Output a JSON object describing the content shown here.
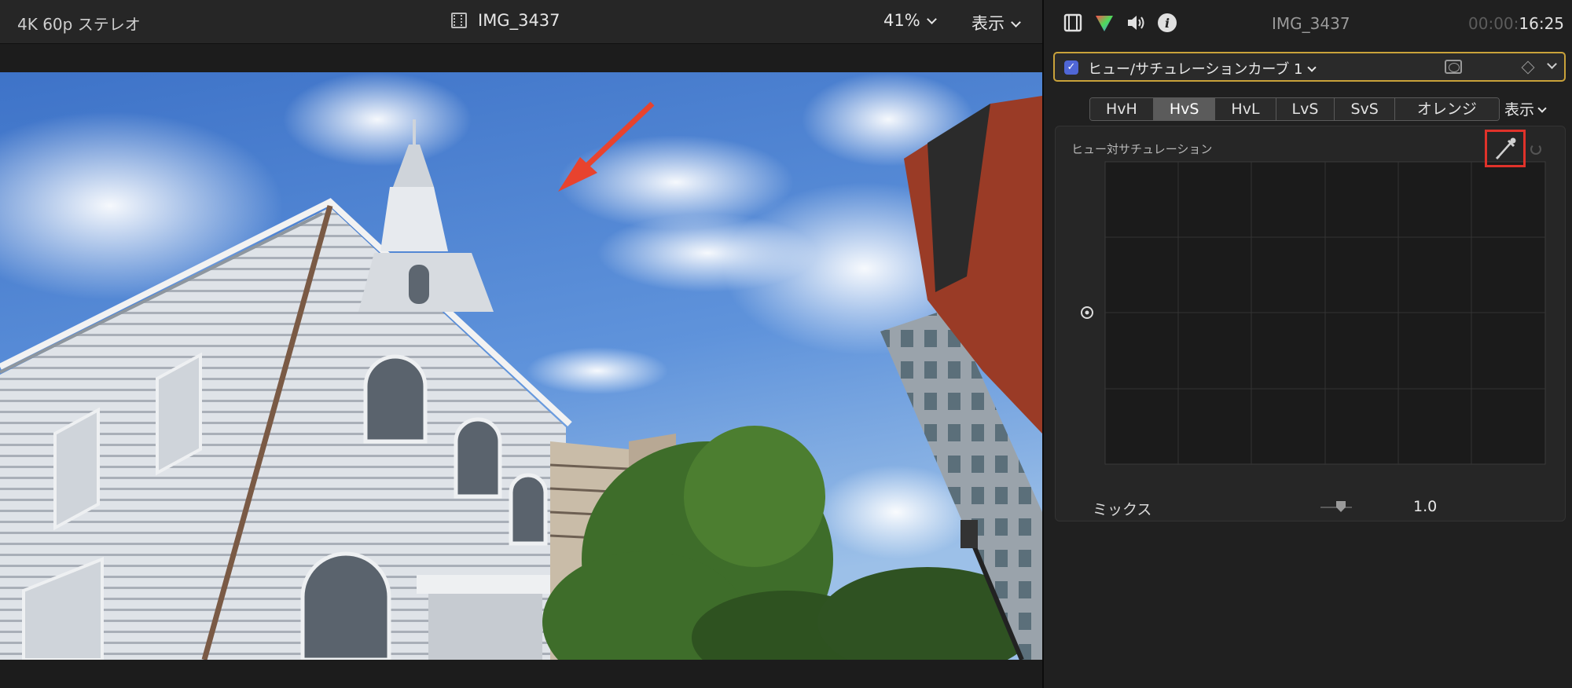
{
  "viewer": {
    "format": "4K 60p ステレオ",
    "clip_name": "IMG_3437",
    "zoom": "41%",
    "view_menu": "表示"
  },
  "inspector": {
    "clip_name": "IMG_3437",
    "timecode_dim": "00:00:",
    "timecode": "16:25",
    "icons": [
      "film-icon",
      "color-icon",
      "audio-icon",
      "info-icon"
    ]
  },
  "effect": {
    "enabled": true,
    "name": "ヒュー/サチュレーションカーブ 1"
  },
  "tabs": [
    {
      "label": "HvH",
      "active": false
    },
    {
      "label": "HvS",
      "active": true
    },
    {
      "label": "HvL",
      "active": false
    },
    {
      "label": "LvS",
      "active": false
    },
    {
      "label": "SvS",
      "active": false
    },
    {
      "label": "オレンジ",
      "active": false
    }
  ],
  "tabs_view_menu": "表示",
  "curve": {
    "title": "ヒュー対サチュレーション"
  },
  "mix": {
    "label": "ミックス",
    "value": "1.0"
  },
  "colors": {
    "accent_border": "#c9a23a",
    "highlight_box": "#e0322a",
    "checkbox": "#4f66d6"
  }
}
